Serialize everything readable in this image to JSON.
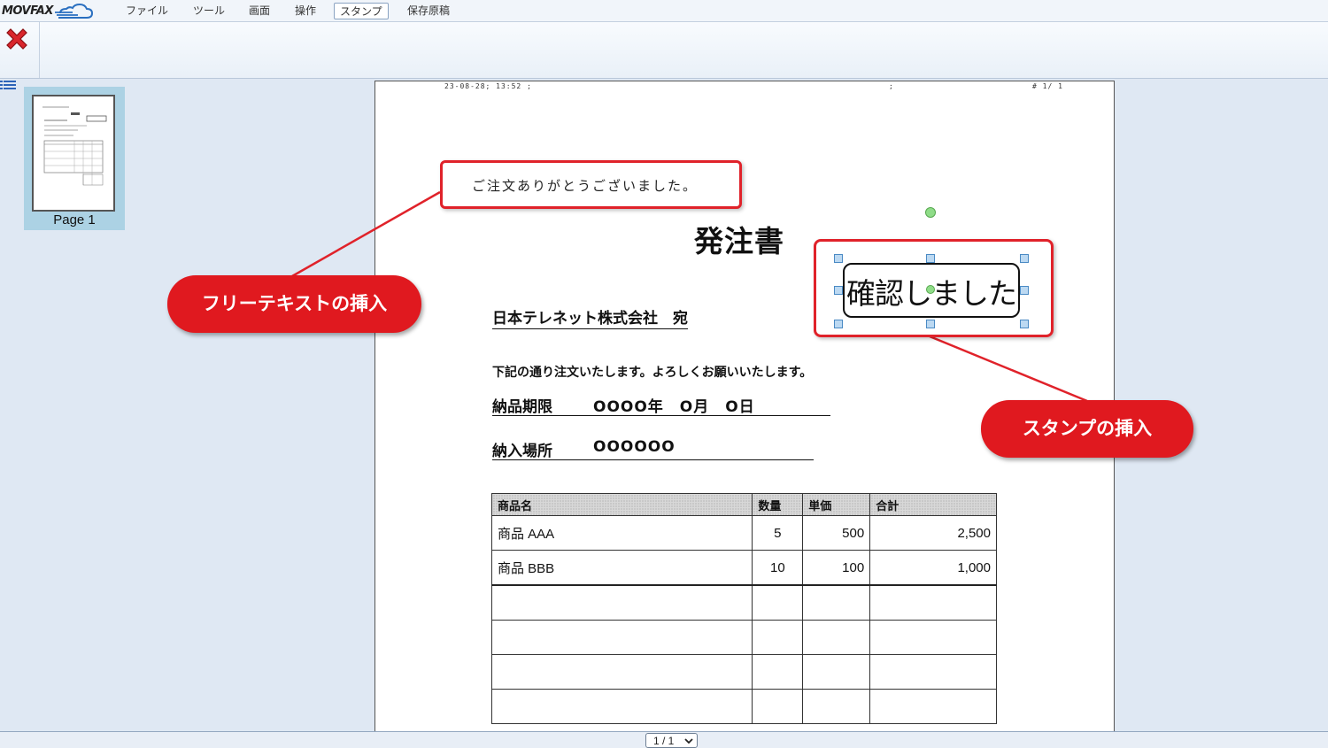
{
  "app": {
    "logo_text": "MOVFAX"
  },
  "menu": [
    {
      "label": "ファイル",
      "active": false
    },
    {
      "label": "ツール",
      "active": false
    },
    {
      "label": "画面",
      "active": false
    },
    {
      "label": "操作",
      "active": false
    },
    {
      "label": "スタンプ",
      "active": true
    },
    {
      "label": "保存原稿",
      "active": false
    }
  ],
  "thumbnail": {
    "label": "Page 1"
  },
  "document": {
    "fax_header": {
      "timestamp": "23-08-28; 13:52 ;",
      "middle": ";",
      "page": "# 1/ 1"
    },
    "free_text": "ご注文ありがとうございました。",
    "title": "発注書",
    "addressee": "日本テレネット株式会社　宛",
    "message": "下記の通り注文いたします。よろしくお願いいたします。",
    "delivery_deadline": {
      "label": "納品期限",
      "value": "OOOO年　O月　O日"
    },
    "delivery_place": {
      "label": "納入場所",
      "value": "OOOOOO"
    },
    "table": {
      "headers": [
        "商品名",
        "数量",
        "単価",
        "合計"
      ],
      "rows": [
        {
          "name": "商品 AAA",
          "qty": "5",
          "price": "500",
          "total": "2,500"
        },
        {
          "name": "商品 BBB",
          "qty": "10",
          "price": "100",
          "total": "1,000"
        }
      ]
    },
    "stamp_text": "確認しました"
  },
  "callouts": {
    "free_text": "フリーテキストの挿入",
    "stamp": "スタンプの挿入"
  },
  "pager": {
    "value": "1 / 1"
  },
  "colors": {
    "callout_red": "#e0191f",
    "thumb_selected": "#acd2e4",
    "close_red": "#d9262c"
  }
}
